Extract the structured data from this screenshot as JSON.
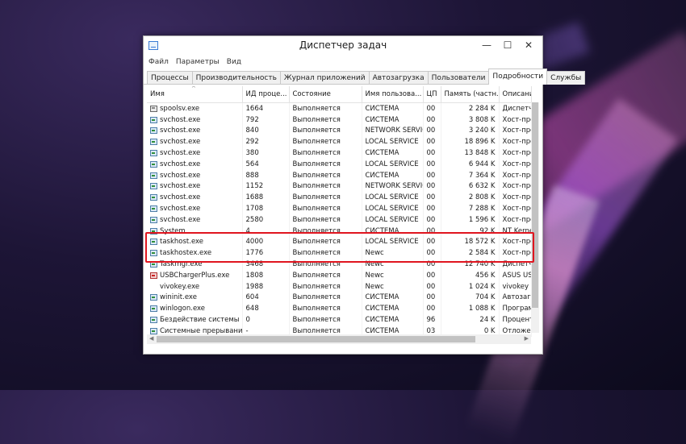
{
  "window": {
    "title": "Диспетчер задач",
    "minimize": "—",
    "maximize": "☐",
    "close": "✕"
  },
  "menu": [
    "Файл",
    "Параметры",
    "Вид"
  ],
  "tabs": [
    "Процессы",
    "Производительность",
    "Журнал приложений",
    "Автозагрузка",
    "Пользователи",
    "Подробности",
    "Службы"
  ],
  "active_tab": "Подробности",
  "columns": [
    "Имя",
    "ИД проце...",
    "Состояние",
    "Имя пользова...",
    "ЦП",
    "Память (частн...",
    "Описани"
  ],
  "rows": [
    {
      "icon": "printer-icon",
      "name": "spoolsv.exe",
      "pid": "1664",
      "status": "Выполняется",
      "user": "СИСТЕМА",
      "cpu": "00",
      "mem": "2 284 K",
      "desc": "Диспетче"
    },
    {
      "icon": "process-icon",
      "name": "svchost.exe",
      "pid": "792",
      "status": "Выполняется",
      "user": "СИСТЕМА",
      "cpu": "00",
      "mem": "3 808 K",
      "desc": "Хост-про"
    },
    {
      "icon": "process-icon",
      "name": "svchost.exe",
      "pid": "840",
      "status": "Выполняется",
      "user": "NETWORK SERVICE",
      "cpu": "00",
      "mem": "3 240 K",
      "desc": "Хост-про"
    },
    {
      "icon": "process-icon",
      "name": "svchost.exe",
      "pid": "292",
      "status": "Выполняется",
      "user": "LOCAL SERVICE",
      "cpu": "00",
      "mem": "18 896 K",
      "desc": "Хост-про"
    },
    {
      "icon": "process-icon",
      "name": "svchost.exe",
      "pid": "380",
      "status": "Выполняется",
      "user": "СИСТЕМА",
      "cpu": "00",
      "mem": "13 848 K",
      "desc": "Хост-про"
    },
    {
      "icon": "process-icon",
      "name": "svchost.exe",
      "pid": "564",
      "status": "Выполняется",
      "user": "LOCAL SERVICE",
      "cpu": "00",
      "mem": "6 944 K",
      "desc": "Хост-про"
    },
    {
      "icon": "process-icon",
      "name": "svchost.exe",
      "pid": "888",
      "status": "Выполняется",
      "user": "СИСТЕМА",
      "cpu": "00",
      "mem": "7 364 K",
      "desc": "Хост-про"
    },
    {
      "icon": "process-icon",
      "name": "svchost.exe",
      "pid": "1152",
      "status": "Выполняется",
      "user": "NETWORK SERVICE",
      "cpu": "00",
      "mem": "6 632 K",
      "desc": "Хост-про"
    },
    {
      "icon": "process-icon",
      "name": "svchost.exe",
      "pid": "1688",
      "status": "Выполняется",
      "user": "LOCAL SERVICE",
      "cpu": "00",
      "mem": "2 808 K",
      "desc": "Хост-про"
    },
    {
      "icon": "process-icon",
      "name": "svchost.exe",
      "pid": "1708",
      "status": "Выполняется",
      "user": "LOCAL SERVICE",
      "cpu": "00",
      "mem": "7 288 K",
      "desc": "Хост-про"
    },
    {
      "icon": "process-icon",
      "name": "svchost.exe",
      "pid": "2580",
      "status": "Выполняется",
      "user": "LOCAL SERVICE",
      "cpu": "00",
      "mem": "1 596 K",
      "desc": "Хост-про"
    },
    {
      "icon": "process-icon",
      "name": "System",
      "pid": "4",
      "status": "Выполняется",
      "user": "СИСТЕМА",
      "cpu": "00",
      "mem": "92 K",
      "desc": "NT Kernel"
    },
    {
      "icon": "process-icon",
      "name": "taskhost.exe",
      "pid": "4000",
      "status": "Выполняется",
      "user": "LOCAL SERVICE",
      "cpu": "00",
      "mem": "18 572 K",
      "desc": "Хост-про"
    },
    {
      "icon": "process-icon",
      "name": "taskhostex.exe",
      "pid": "1776",
      "status": "Выполняется",
      "user": "Newc",
      "cpu": "00",
      "mem": "2 584 K",
      "desc": "Хост-про"
    },
    {
      "icon": "process-icon",
      "name": "Taskmgr.exe",
      "pid": "3468",
      "status": "Выполняется",
      "user": "Newc",
      "cpu": "00",
      "mem": "12 740 K",
      "desc": "Диспетче"
    },
    {
      "icon": "usb-icon",
      "name": "USBChargerPlus.exe",
      "pid": "1808",
      "status": "Выполняется",
      "user": "Newc",
      "cpu": "00",
      "mem": "456 K",
      "desc": "ASUS USB"
    },
    {
      "icon": "blank-icon",
      "name": "vivokey.exe",
      "pid": "1988",
      "status": "Выполняется",
      "user": "Newc",
      "cpu": "00",
      "mem": "1 024 K",
      "desc": "vivokey"
    },
    {
      "icon": "process-icon",
      "name": "wininit.exe",
      "pid": "604",
      "status": "Выполняется",
      "user": "СИСТЕМА",
      "cpu": "00",
      "mem": "704 K",
      "desc": "Автозагр"
    },
    {
      "icon": "process-icon",
      "name": "winlogon.exe",
      "pid": "648",
      "status": "Выполняется",
      "user": "СИСТЕМА",
      "cpu": "00",
      "mem": "1 088 K",
      "desc": "Програм"
    },
    {
      "icon": "process-icon",
      "name": "Бездействие системы",
      "pid": "0",
      "status": "Выполняется",
      "user": "СИСТЕМА",
      "cpu": "96",
      "mem": "24 K",
      "desc": "Процент"
    },
    {
      "icon": "process-icon",
      "name": "Системные прерывания",
      "pid": "-",
      "status": "Выполняется",
      "user": "СИСТЕМА",
      "cpu": "03",
      "mem": "0 K",
      "desc": "Отложен"
    }
  ]
}
